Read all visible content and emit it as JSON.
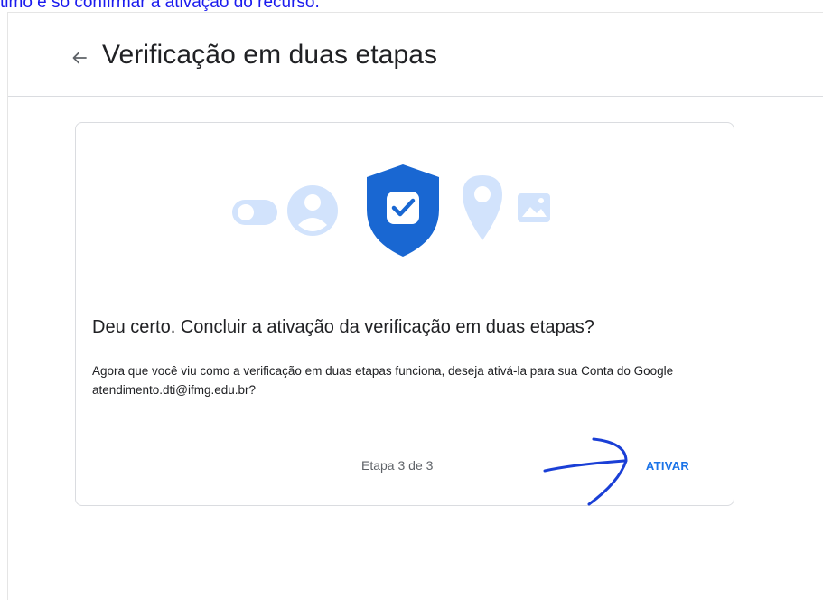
{
  "caption": {
    "text": "timo e só confirmar a ativação do recurso."
  },
  "header": {
    "back_icon": "arrow-back-icon",
    "title": "Verificação em duas etapas"
  },
  "card": {
    "heading": "Deu certo. Concluir a ativação da verificação em duas etapas?",
    "body": "Agora que você viu como a verificação em duas etapas funciona, deseja ativá-la para sua Conta do Google atendimento.dti@ifmg.edu.br?",
    "step": "Etapa 3 de 3",
    "activate_label": "ATIVAR"
  },
  "illustration": {
    "icons": [
      "toggle-icon",
      "person-icon",
      "shield-check-icon",
      "location-pin-icon",
      "image-icon"
    ]
  },
  "colors": {
    "accent": "#1a73e8",
    "shield": "#1967d2",
    "light_icon": "#d2e3fc",
    "annotation": "#1a3fd6"
  }
}
